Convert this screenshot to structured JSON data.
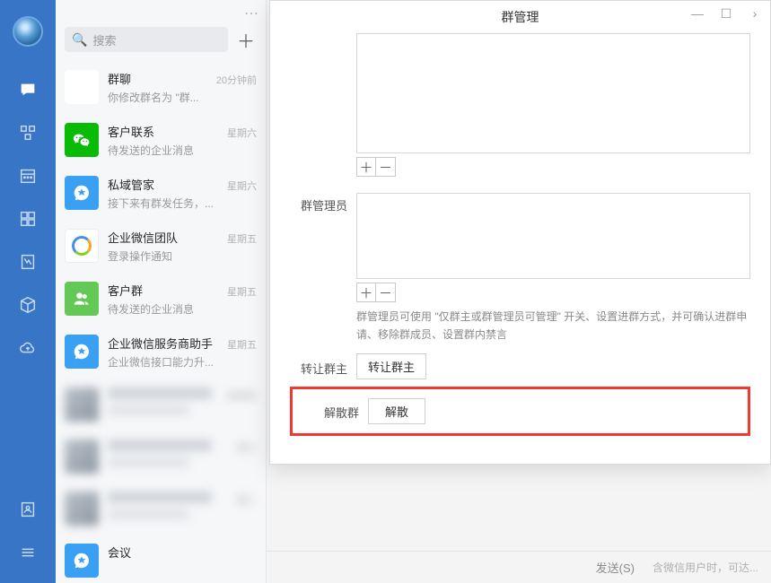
{
  "search": {
    "placeholder": "搜索"
  },
  "conversations": [
    {
      "title": "群聊",
      "sub": "你修改群名为 \"群...",
      "time": "20分钟前",
      "avatar": "group"
    },
    {
      "title": "客户联系",
      "sub": "待发送的企业消息",
      "time": "星期六",
      "avatar": "wechat"
    },
    {
      "title": "私域管家",
      "sub": "接下来有群发任务，...",
      "time": "星期六",
      "avatar": "blue"
    },
    {
      "title": "企业微信团队",
      "sub": "登录操作通知",
      "time": "星期五",
      "avatar": "team"
    },
    {
      "title": "客户群",
      "sub": "待发送的企业消息",
      "time": "星期五",
      "avatar": "green"
    },
    {
      "title": "企业微信服务商助手",
      "sub": "企业微信接口能力升...",
      "time": "星期五",
      "avatar": "blue"
    },
    {
      "title": "",
      "sub": "",
      "time": "星期四",
      "avatar": "gen"
    },
    {
      "title": "",
      "sub": "",
      "time": "期三",
      "avatar": "gen"
    },
    {
      "title": "",
      "sub": "",
      "time": "期二",
      "avatar": "gen"
    },
    {
      "title": "会议",
      "sub": "",
      "time": "",
      "avatar": "blue"
    }
  ],
  "modal": {
    "title": "群管理",
    "admin_label": "群管理员",
    "admin_desc": "群管理员可使用 \"仅群主或群管理员可管理\" 开关、设置进群方式，并可确认进群申请、移除群成员、设置群内禁言",
    "transfer_label": "转让群主",
    "transfer_btn": "转让群主",
    "dismiss_label": "解散群",
    "dismiss_btn": "解散",
    "plus": "＋",
    "minus": "－"
  },
  "bottom": {
    "send": "发送(S)",
    "hint": "含微信用户时，可达..."
  }
}
